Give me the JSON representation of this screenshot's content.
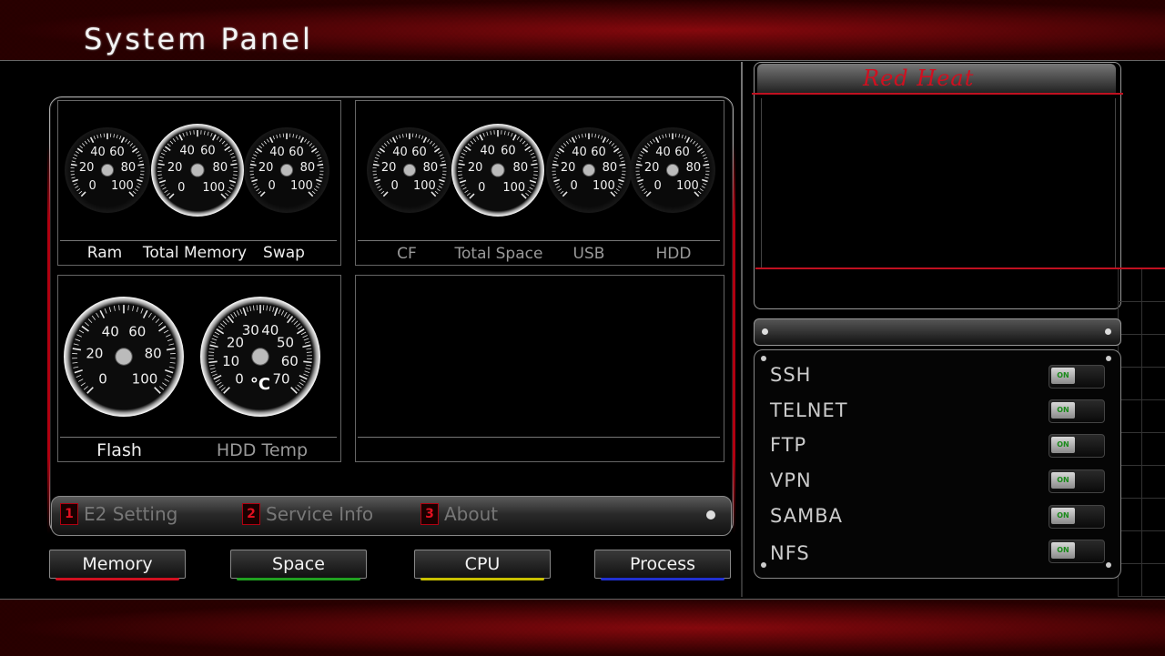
{
  "header": {
    "title": "System Panel"
  },
  "gauges_top_left": {
    "labels": [
      "Ram",
      "Total Memory",
      "Swap"
    ],
    "scale": [
      "0",
      "20",
      "40",
      "60",
      "80",
      "100"
    ]
  },
  "gauges_top_right": {
    "labels": [
      "CF",
      "Total Space",
      "USB",
      "HDD"
    ]
  },
  "gauges_bottom": {
    "flash_label": "Flash",
    "hddtemp_label": "HDD Temp",
    "temp_scale": [
      "0",
      "10",
      "20",
      "30",
      "40",
      "50",
      "60",
      "70"
    ],
    "temp_unit": "°C"
  },
  "navbar": {
    "items": [
      {
        "num": "1",
        "label": "E2 Setting"
      },
      {
        "num": "2",
        "label": "Service Info"
      },
      {
        "num": "3",
        "label": "About"
      }
    ]
  },
  "buttons": [
    {
      "label": "Memory",
      "color": "#d01020"
    },
    {
      "label": "Space",
      "color": "#20a020"
    },
    {
      "label": "CPU",
      "color": "#c8c000"
    },
    {
      "label": "Process",
      "color": "#2030d0"
    }
  ],
  "preview": {
    "title": "Red Heat"
  },
  "services": [
    {
      "name": "SSH",
      "state": "ON"
    },
    {
      "name": "TELNET",
      "state": "ON"
    },
    {
      "name": "FTP",
      "state": "ON"
    },
    {
      "name": "VPN",
      "state": "ON"
    },
    {
      "name": "SAMBA",
      "state": "ON"
    },
    {
      "name": "NFS",
      "state": "ON"
    }
  ]
}
